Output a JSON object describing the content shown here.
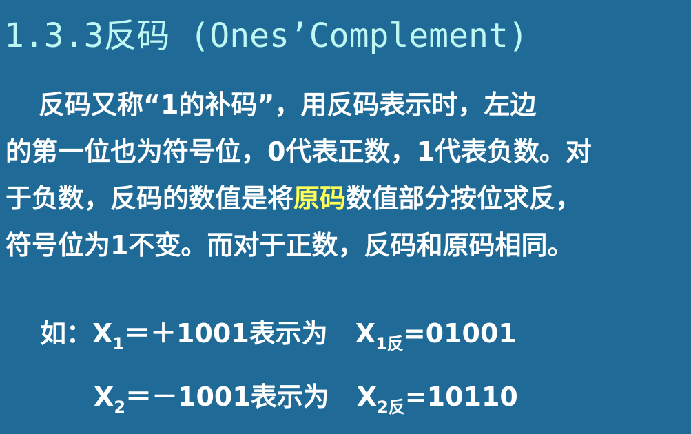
{
  "title": "1.3.3反码 (Ones’Complement)",
  "paragraph": {
    "line1": "反码又称“1的补码”，用反码表示时，左边",
    "line2": "的第一位也为符号位，0代表正数，1代表负数。对",
    "line3_before": "于负数，反码的数值是将",
    "line3_highlight": "原码",
    "line3_after": "数值部分按位求反，",
    "line4": "符号位为1不变。而对于正数，反码和原码相同。"
  },
  "examples": [
    {
      "prefix": "如：",
      "var": "X",
      "sub": "1",
      "expr": "＝＋1001表示为",
      "res_var": "X",
      "res_sub": "1反",
      "res_val": "=01001"
    },
    {
      "prefix": "",
      "var": "X",
      "sub": "2",
      "expr": "＝－1001表示为",
      "res_var": "X",
      "res_sub": "2反",
      "res_val": "=10110"
    }
  ],
  "colors": {
    "background": "#1f6a96",
    "title": "#bff8f3",
    "text": "#ffffff",
    "highlight": "#ffff55"
  }
}
